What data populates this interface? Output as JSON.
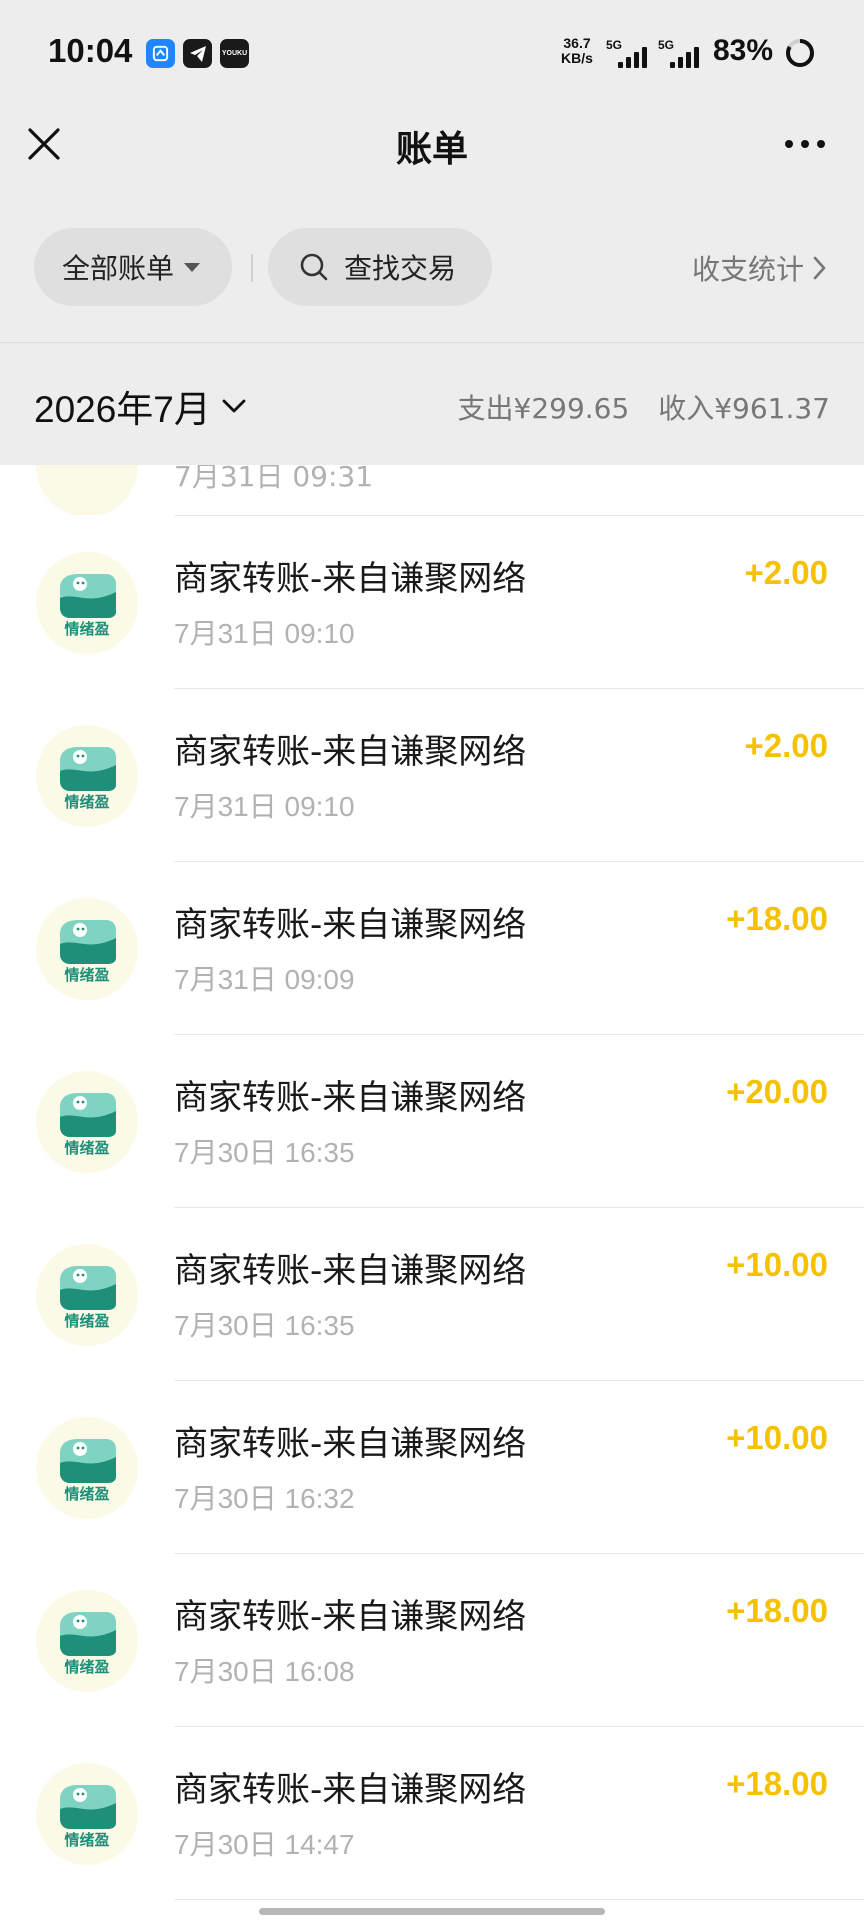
{
  "status_bar": {
    "time": "10:04",
    "net_speed_value": "36.7",
    "net_speed_unit": "KB/s",
    "signal1_label": "5G",
    "signal2_label": "5G",
    "battery": "83%",
    "app_icons": [
      "lenovo-app-icon",
      "telegram-icon",
      "youku-icon"
    ],
    "youku_label": "YOUKU"
  },
  "nav": {
    "title": "账单"
  },
  "filters": {
    "all_bills_label": "全部账单",
    "search_label": "查找交易",
    "stats_label": "收支统计"
  },
  "month": {
    "label": "2026年7月",
    "expense": "支出¥299.65",
    "income": "收入¥961.37"
  },
  "partial_row": {
    "date": "7月31日 09:31"
  },
  "brand_label": "情绪盈",
  "colors": {
    "income_amount": "#f5c100",
    "brand_green": "#1f8f7a",
    "page_grey": "#ededed"
  },
  "transactions": [
    {
      "name": "商家转账-来自谦聚网络",
      "date": "7月31日 09:10",
      "amount": "+2.00"
    },
    {
      "name": "商家转账-来自谦聚网络",
      "date": "7月31日 09:10",
      "amount": "+2.00"
    },
    {
      "name": "商家转账-来自谦聚网络",
      "date": "7月31日 09:09",
      "amount": "+18.00"
    },
    {
      "name": "商家转账-来自谦聚网络",
      "date": "7月30日 16:35",
      "amount": "+20.00"
    },
    {
      "name": "商家转账-来自谦聚网络",
      "date": "7月30日 16:35",
      "amount": "+10.00"
    },
    {
      "name": "商家转账-来自谦聚网络",
      "date": "7月30日 16:32",
      "amount": "+10.00"
    },
    {
      "name": "商家转账-来自谦聚网络",
      "date": "7月30日 16:08",
      "amount": "+18.00"
    },
    {
      "name": "商家转账-来自谦聚网络",
      "date": "7月30日 14:47",
      "amount": "+18.00"
    }
  ]
}
